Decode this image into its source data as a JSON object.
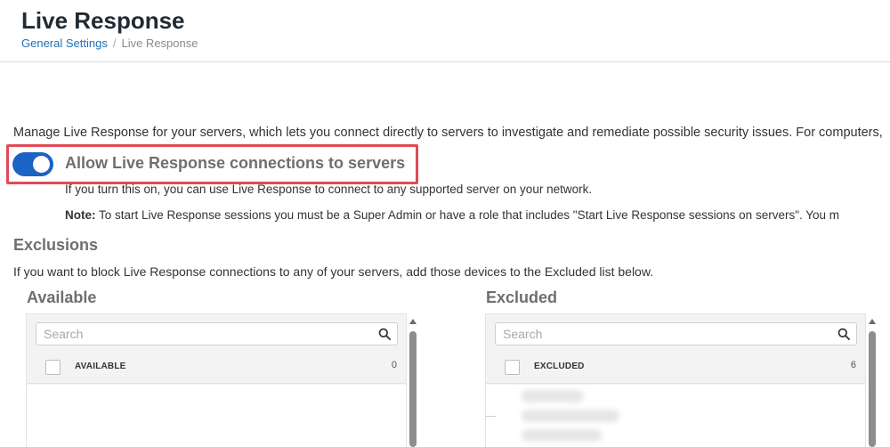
{
  "page": {
    "title": "Live Response",
    "breadcrumb": {
      "parent": "General Settings",
      "separator": "/",
      "current": "Live Response"
    }
  },
  "intro_text": "Manage Live Response for your servers, which lets you connect directly to servers to investigate and remediate possible security issues. For computers,",
  "toggle": {
    "label": "Allow Live Response connections to servers",
    "state": "on",
    "accent_color": "#1b63c4",
    "highlight_color": "#e04b57"
  },
  "help": {
    "line1": "If you turn this on, you can use Live Response to connect to any supported server on your network.",
    "note_label": "Note:",
    "note_text": " To start Live Response sessions you must be a Super Admin or have a role that includes \"Start Live Response sessions on servers\". You m"
  },
  "exclusions": {
    "title": "Exclusions",
    "description": "If you want to block Live Response connections to any of your servers, add those devices to the Excluded list below."
  },
  "available": {
    "title": "Available",
    "search_placeholder": "Search",
    "header_label": "AVAILABLE",
    "count": "0"
  },
  "excluded": {
    "title": "Excluded",
    "search_placeholder": "Search",
    "header_label": "EXCLUDED",
    "count": "6"
  },
  "icons": {
    "search": "search-icon",
    "scroll_up": "triangle-up-icon"
  }
}
